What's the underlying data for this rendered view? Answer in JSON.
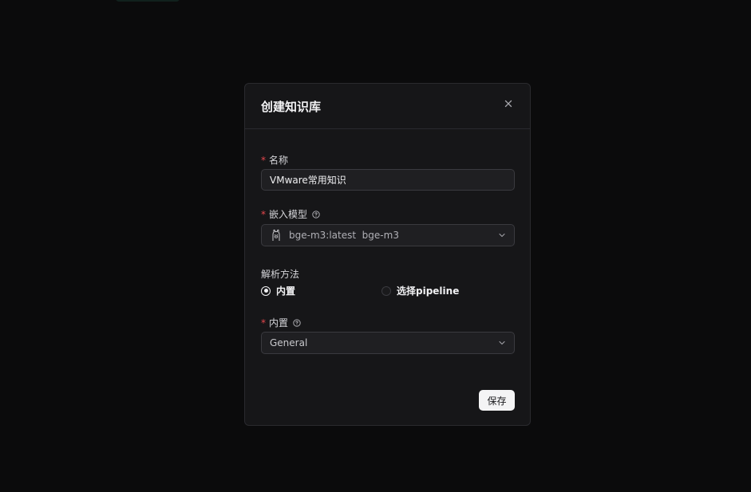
{
  "modal": {
    "title": "创建知识库",
    "close_icon": "close-icon"
  },
  "name_field": {
    "label": "名称",
    "required_mark": "*",
    "value": "VMware常用知识"
  },
  "embed_field": {
    "label": "嵌入模型",
    "required_mark": "*",
    "help_icon": "question-circle-icon",
    "model_icon": "ollama-llama-icon",
    "selected_value": "bge-m3:latest  bge-m3",
    "chevron_icon": "chevron-down-icon"
  },
  "parse_method": {
    "label": "解析方法",
    "options": [
      {
        "label": "内置",
        "checked": true
      },
      {
        "label": "选择pipeline",
        "checked": false
      }
    ]
  },
  "builtin_field": {
    "label": "内置",
    "required_mark": "*",
    "help_icon": "question-circle-icon",
    "selected_value": "General",
    "chevron_icon": "chevron-down-icon"
  },
  "footer": {
    "save_label": "保存"
  },
  "colors": {
    "background": "#0b0b0c",
    "modal": "#161618",
    "border": "#2a2a2e",
    "required": "#e5484d",
    "primary_button": "#f4f4f5"
  }
}
